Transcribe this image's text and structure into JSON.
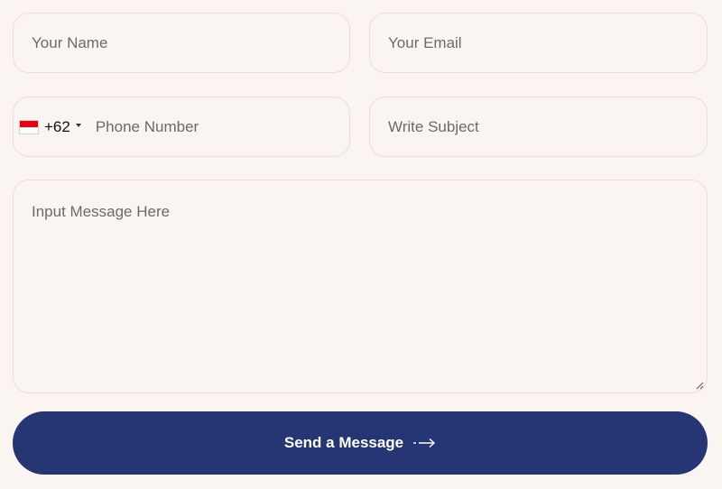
{
  "form": {
    "name": {
      "value": "",
      "placeholder": "Your Name"
    },
    "email": {
      "value": "",
      "placeholder": "Your Email"
    },
    "phone": {
      "country_flag": "indonesia-flag-icon",
      "dial_code": "+62",
      "value": "",
      "placeholder": "Phone Number"
    },
    "subject": {
      "value": "",
      "placeholder": "Write Subject"
    },
    "message": {
      "value": "",
      "placeholder": "Input Message Here"
    },
    "submit_label": "Send a Message",
    "submit_icon": "arrow-right-icon"
  },
  "colors": {
    "background": "#faf5f1",
    "field_border": "#e8dfd7",
    "placeholder": "#6f6a66",
    "button": "#263574",
    "button_text": "#ffffff"
  }
}
